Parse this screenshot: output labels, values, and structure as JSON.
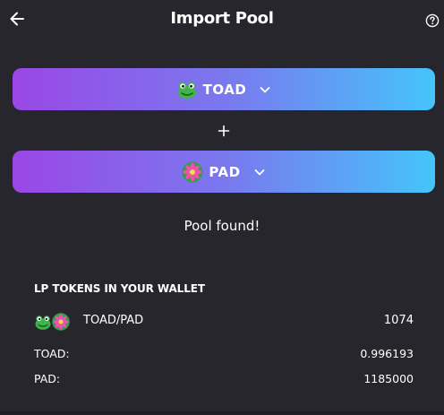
{
  "header": {
    "title": "Import Pool",
    "back_icon": "arrow-left-icon",
    "help_icon": "help-circle-icon"
  },
  "token_a": {
    "symbol": "TOAD",
    "icon": "frog-icon"
  },
  "token_b": {
    "symbol": "PAD",
    "icon": "flower-icon"
  },
  "plus_icon": "plus-icon",
  "status": {
    "message": "Pool found!"
  },
  "lp": {
    "heading": "LP TOKENS IN YOUR WALLET",
    "pair": "TOAD/PAD",
    "pair_balance": "1074",
    "rows": [
      {
        "label": "TOAD:",
        "value": "0.996193"
      },
      {
        "label": "PAD:",
        "value": "1185000"
      }
    ]
  },
  "colors": {
    "background": "#27262c",
    "gradient_start": "#9a47e6",
    "gradient_end": "#45c4fb",
    "text": "#ffffff"
  }
}
